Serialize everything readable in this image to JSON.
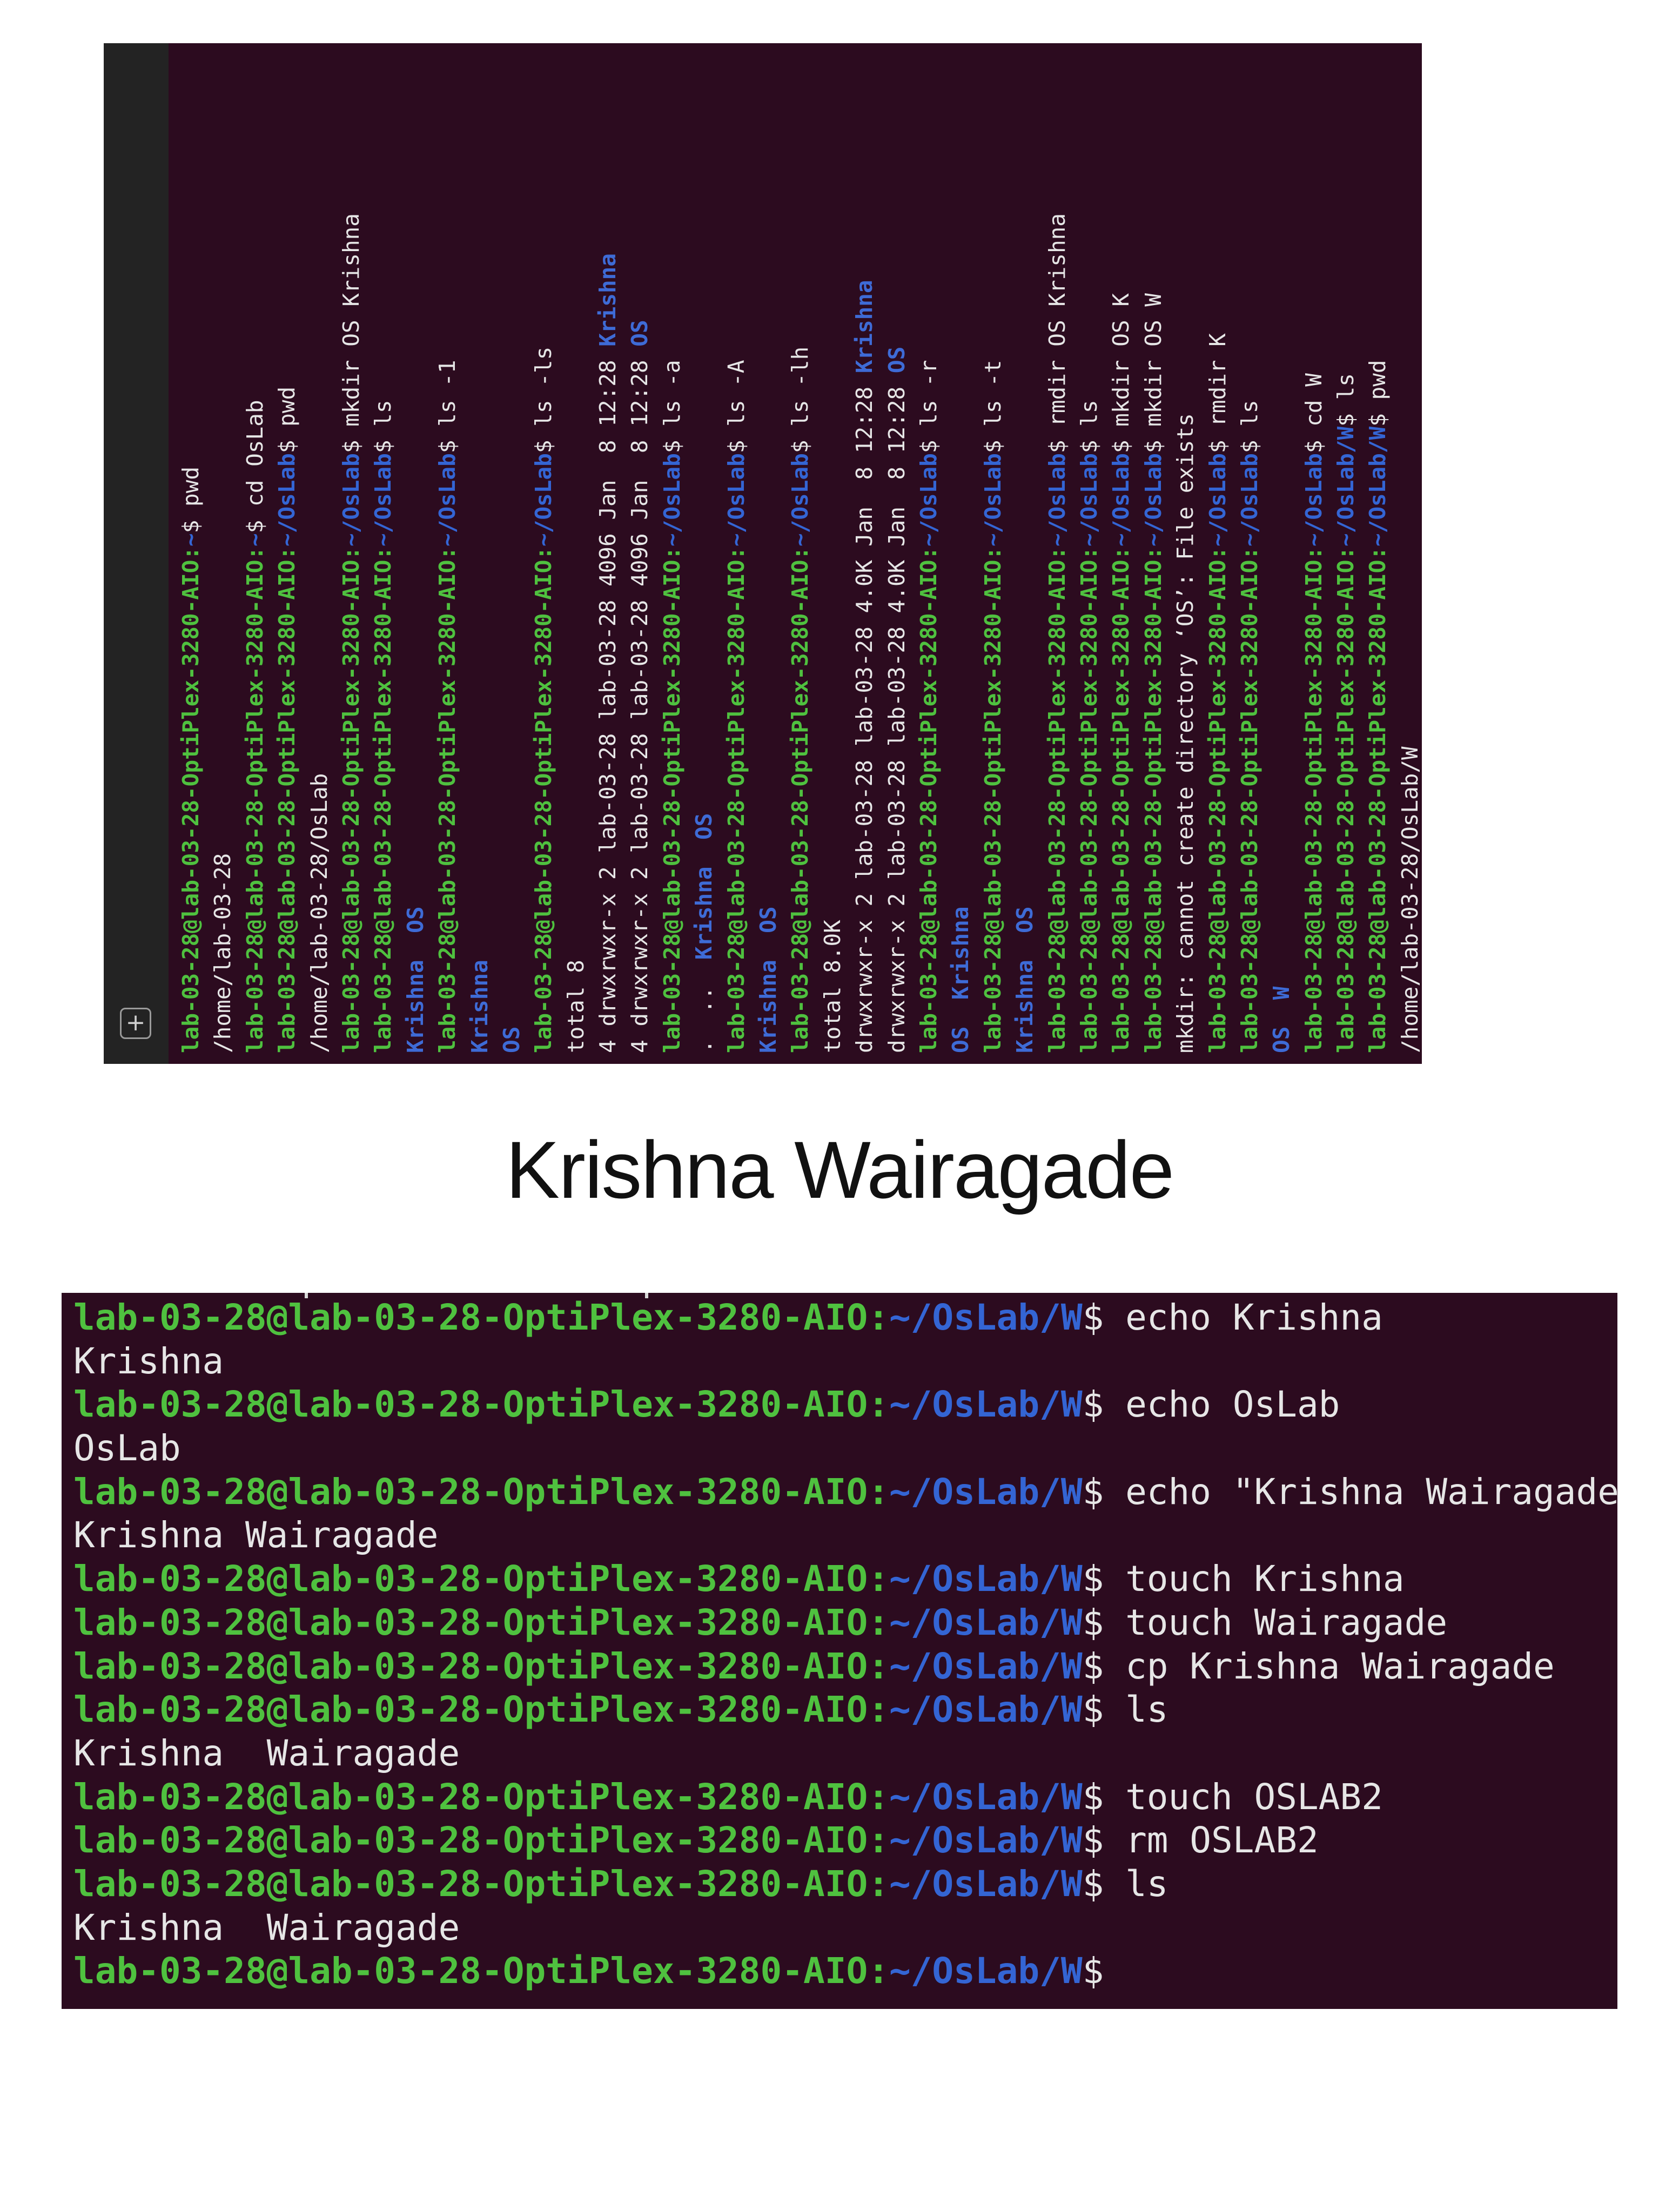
{
  "top_terminal": {
    "new_tab_icon": "+",
    "prompt_user": "lab-03-28@lab-03-28-OptiPlex-3280-AIO",
    "lines": [
      {
        "prompt": true,
        "path": "~",
        "cmd": "pwd"
      },
      {
        "text": "/home/lab-03-28"
      },
      {
        "prompt": true,
        "path": "~",
        "cmd": "cd OsLab"
      },
      {
        "prompt": true,
        "path": "~/OsLab",
        "cmd": "pwd"
      },
      {
        "text": "/home/lab-03-28/OsLab"
      },
      {
        "prompt": true,
        "path": "~/OsLab",
        "cmd": "mkdir OS Krishna"
      },
      {
        "prompt": true,
        "path": "~/OsLab",
        "cmd": "ls"
      },
      {
        "dirs": [
          "Krishna",
          "OS"
        ],
        "sep": "  "
      },
      {
        "prompt": true,
        "path": "~/OsLab",
        "cmd": "ls -1"
      },
      {
        "dirs": [
          "Krishna"
        ]
      },
      {
        "dirs": [
          "OS"
        ]
      },
      {
        "prompt": true,
        "path": "~/OsLab",
        "cmd": "ls -ls"
      },
      {
        "text": "total 8"
      },
      {
        "text": "4 drwxrwxr-x 2 lab-03-28 lab-03-28 4096 Jan  8 12:28 ",
        "dir": "Krishna"
      },
      {
        "text": "4 drwxrwxr-x 2 lab-03-28 lab-03-28 4096 Jan  8 12:28 ",
        "dir": "OS"
      },
      {
        "prompt": true,
        "path": "~/OsLab",
        "cmd": "ls -a"
      },
      {
        "text": ".  ..  ",
        "dirs": [
          "Krishna",
          "OS"
        ],
        "sep": "  "
      },
      {
        "prompt": true,
        "path": "~/OsLab",
        "cmd": "ls -A"
      },
      {
        "dirs": [
          "Krishna",
          "OS"
        ],
        "sep": "  "
      },
      {
        "prompt": true,
        "path": "~/OsLab",
        "cmd": "ls -lh"
      },
      {
        "text": "total 8.0K"
      },
      {
        "text": "drwxrwxr-x 2 lab-03-28 lab-03-28 4.0K Jan  8 12:28 ",
        "dir": "Krishna"
      },
      {
        "text": "drwxrwxr-x 2 lab-03-28 lab-03-28 4.0K Jan  8 12:28 ",
        "dir": "OS"
      },
      {
        "prompt": true,
        "path": "~/OsLab",
        "cmd": "ls -r"
      },
      {
        "dirs": [
          "OS",
          "Krishna"
        ],
        "sep": "  "
      },
      {
        "prompt": true,
        "path": "~/OsLab",
        "cmd": "ls -t"
      },
      {
        "dirs": [
          "Krishna",
          "OS"
        ],
        "sep": "  "
      },
      {
        "prompt": true,
        "path": "~/OsLab",
        "cmd": "rmdir OS Krishna"
      },
      {
        "prompt": true,
        "path": "~/OsLab",
        "cmd": "ls"
      },
      {
        "prompt": true,
        "path": "~/OsLab",
        "cmd": "mkdir OS K"
      },
      {
        "prompt": true,
        "path": "~/OsLab",
        "cmd": "mkdir OS W"
      },
      {
        "text": "mkdir: cannot create directory ‘OS’: File exists"
      },
      {
        "prompt": true,
        "path": "~/OsLab",
        "cmd": "rmdir K"
      },
      {
        "prompt": true,
        "path": "~/OsLab",
        "cmd": "ls"
      },
      {
        "dirs": [
          "OS",
          "W"
        ],
        "sep": "  "
      },
      {
        "prompt": true,
        "path": "~/OsLab",
        "cmd": "cd W"
      },
      {
        "prompt": true,
        "path": "~/OsLab/W",
        "cmd": "ls"
      },
      {
        "prompt": true,
        "path": "~/OsLab/W",
        "cmd": "pwd"
      },
      {
        "text": "/home/lab-03-28/OsLab/W"
      }
    ]
  },
  "caption": "Krishna Wairagade",
  "bottom_terminal": {
    "prompt_user": "lab-03-28@lab-03-28-OptiPlex-3280-AIO",
    "prompt_path": "~/OsLab/W",
    "lines": [
      {
        "prompt": true,
        "cmd": "echo Krishna"
      },
      {
        "text": "Krishna"
      },
      {
        "prompt": true,
        "cmd": "echo OsLab"
      },
      {
        "text": "OsLab"
      },
      {
        "prompt": true,
        "cmd": "echo \"Krishna Wairagade\""
      },
      {
        "text": "Krishna Wairagade"
      },
      {
        "prompt": true,
        "cmd": "touch Krishna"
      },
      {
        "prompt": true,
        "cmd": "touch Wairagade"
      },
      {
        "prompt": true,
        "cmd": "cp Krishna Wairagade"
      },
      {
        "prompt": true,
        "cmd": "ls"
      },
      {
        "text": "Krishna  Wairagade"
      },
      {
        "prompt": true,
        "cmd": "touch OSLAB2"
      },
      {
        "prompt": true,
        "cmd": "rm OSLAB2"
      },
      {
        "prompt": true,
        "cmd": "ls"
      },
      {
        "text": "Krishna  Wairagade"
      },
      {
        "prompt": true,
        "cmd": ""
      }
    ]
  }
}
